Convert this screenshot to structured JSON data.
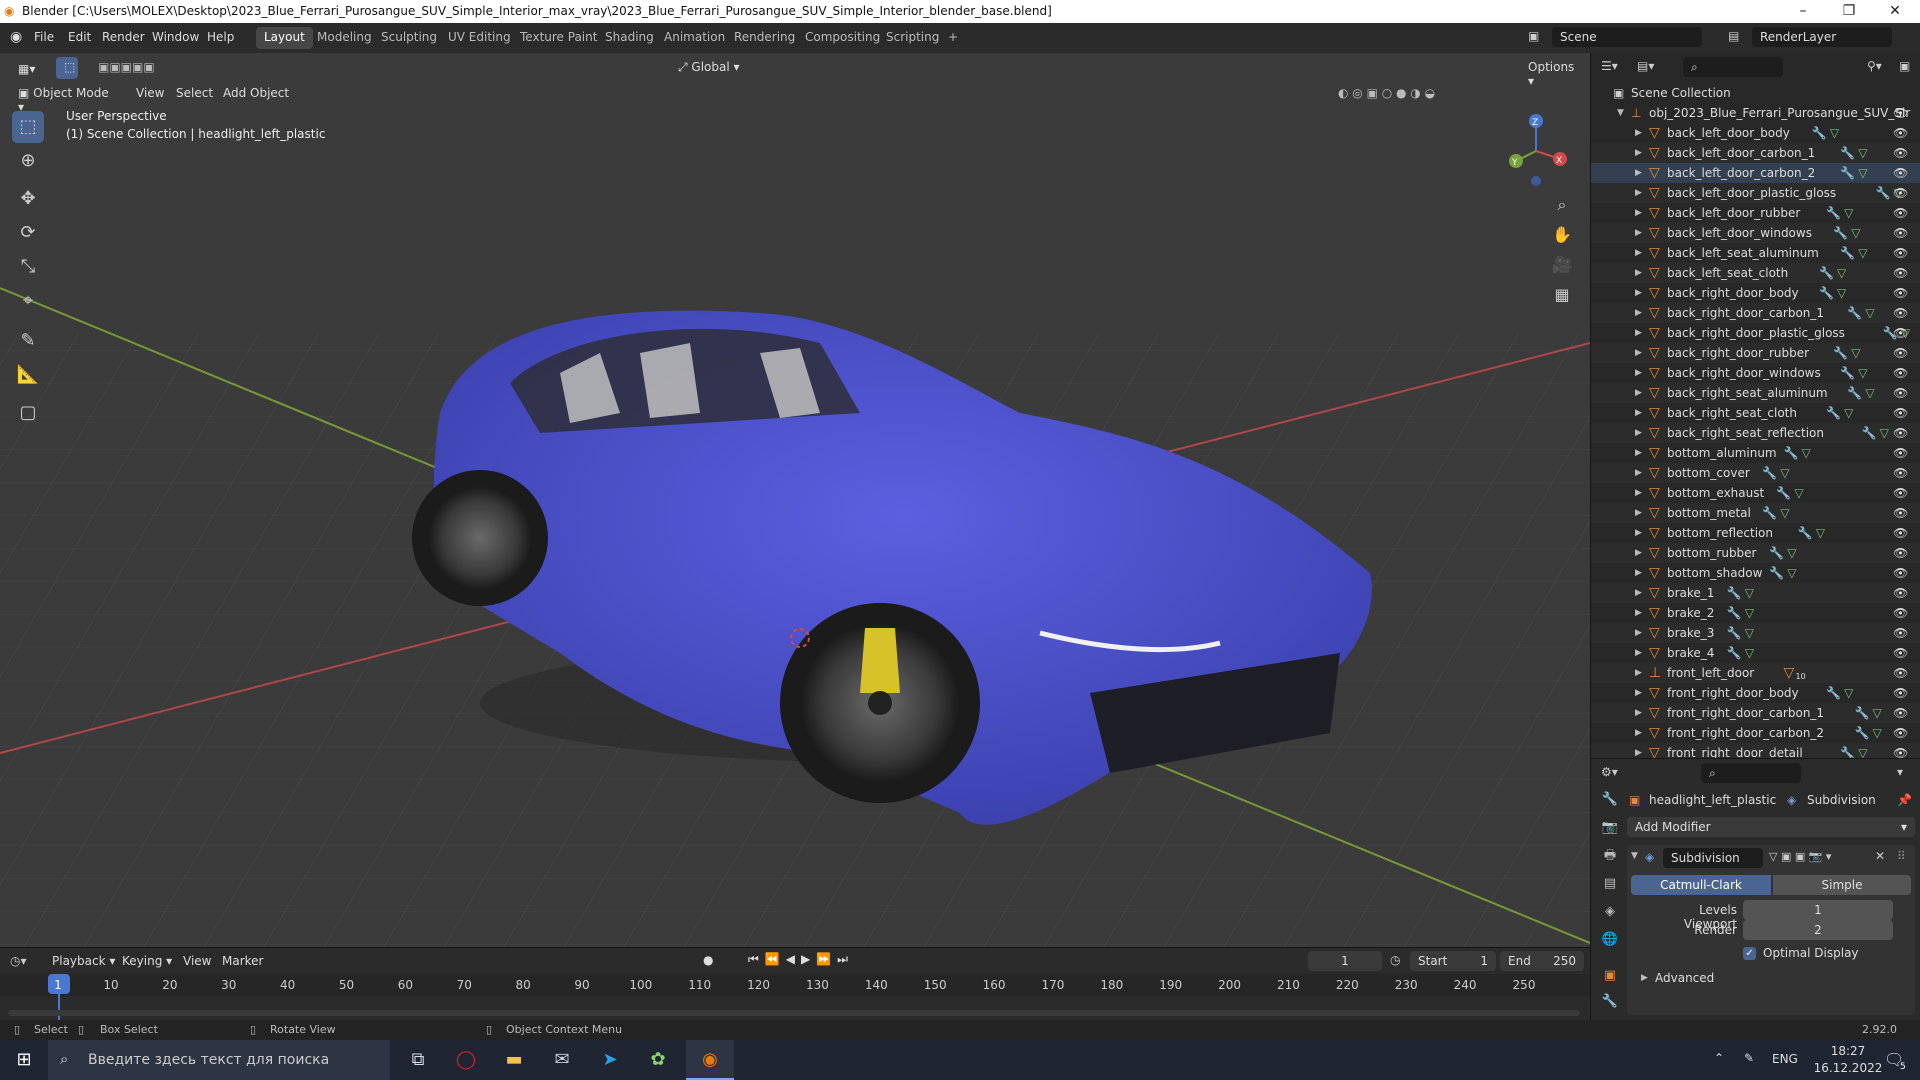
{
  "window": {
    "title": "Blender [C:\\Users\\MOLEX\\Desktop\\2023_Blue_Ferrari_Purosangue_SUV_Simple_Interior_max_vray\\2023_Blue_Ferrari_Purosangue_SUV_Simple_Interior_blender_base.blend]",
    "minimize": "–",
    "maximize": "❐",
    "close": "✕"
  },
  "menus": [
    "File",
    "Edit",
    "Render",
    "Window",
    "Help"
  ],
  "workspaces": [
    "Layout",
    "Modeling",
    "Sculpting",
    "UV Editing",
    "Texture Paint",
    "Shading",
    "Animation",
    "Rendering",
    "Compositing",
    "Scripting"
  ],
  "workspace_add": "+",
  "scene": {
    "name": "Scene",
    "view_layer": "RenderLayer"
  },
  "viewport": {
    "transform_orientation": "Global",
    "options_label": "Options",
    "mode": "Object Mode",
    "header_menus": [
      "View",
      "Select",
      "Add",
      "Object"
    ],
    "overlay_line1": "User Perspective",
    "overlay_line2": "(1) Scene Collection | headlight_left_plastic",
    "gizmo_axes": [
      "X",
      "Y",
      "Z"
    ],
    "car_color": "#4f55d6",
    "grid_color": "#3d3d3d",
    "axis_x_color": "#c84a4a",
    "axis_y_color": "#7fa23a"
  },
  "outliner": {
    "root": "Scene Collection",
    "collection": "obj_2023_Blue_Ferrari_Purosangue_SUV_Sir",
    "items": [
      "back_left_door_body",
      "back_left_door_carbon_1",
      "back_left_door_carbon_2",
      "back_left_door_plastic_gloss",
      "back_left_door_rubber",
      "back_left_door_windows",
      "back_left_seat_aluminum",
      "back_left_seat_cloth",
      "back_right_door_body",
      "back_right_door_carbon_1",
      "back_right_door_plastic_gloss",
      "back_right_door_rubber",
      "back_right_door_windows",
      "back_right_seat_aluminum",
      "back_right_seat_cloth",
      "back_right_seat_reflection",
      "bottom_aluminum",
      "bottom_cover",
      "bottom_exhaust",
      "bottom_metal",
      "bottom_reflection",
      "bottom_rubber",
      "bottom_shadow",
      "brake_1",
      "brake_2",
      "brake_3",
      "brake_4",
      "front_left_door",
      "front_right_door_body",
      "front_right_door_carbon_1",
      "front_right_door_carbon_2",
      "front_right_door_detail"
    ],
    "selected_index": 2,
    "front_left_door_badge": "10"
  },
  "properties": {
    "object_name": "headlight_left_plastic",
    "modifier_context": "Subdivision",
    "add_modifier": "Add Modifier",
    "modifier_name": "Subdivision",
    "catmull": "Catmull-Clark",
    "simple": "Simple",
    "levels_viewport_label": "Levels Viewport",
    "levels_viewport": "1",
    "render_label": "Render",
    "render_value": "2",
    "optimal_display": "Optimal Display",
    "advanced": "Advanced"
  },
  "timeline": {
    "menus": [
      "Playback",
      "Keying",
      "View",
      "Marker"
    ],
    "current_frame": "1",
    "start_label": "Start",
    "start": "1",
    "end_label": "End",
    "end": "250",
    "ticks": [
      "1",
      "10",
      "20",
      "30",
      "40",
      "50",
      "60",
      "70",
      "80",
      "90",
      "100",
      "110",
      "120",
      "130",
      "140",
      "150",
      "160",
      "170",
      "180",
      "190",
      "200",
      "210",
      "220",
      "230",
      "240",
      "250"
    ]
  },
  "statusbar": {
    "select": "Select",
    "box_select": "Box Select",
    "rotate_view": "Rotate View",
    "context_menu": "Object Context Menu",
    "version": "2.92.0"
  },
  "taskbar": {
    "search_placeholder": "Введите здесь текст для поиска",
    "lang": "ENG",
    "time": "18:27",
    "date": "16.12.2022",
    "notifications": "5"
  }
}
